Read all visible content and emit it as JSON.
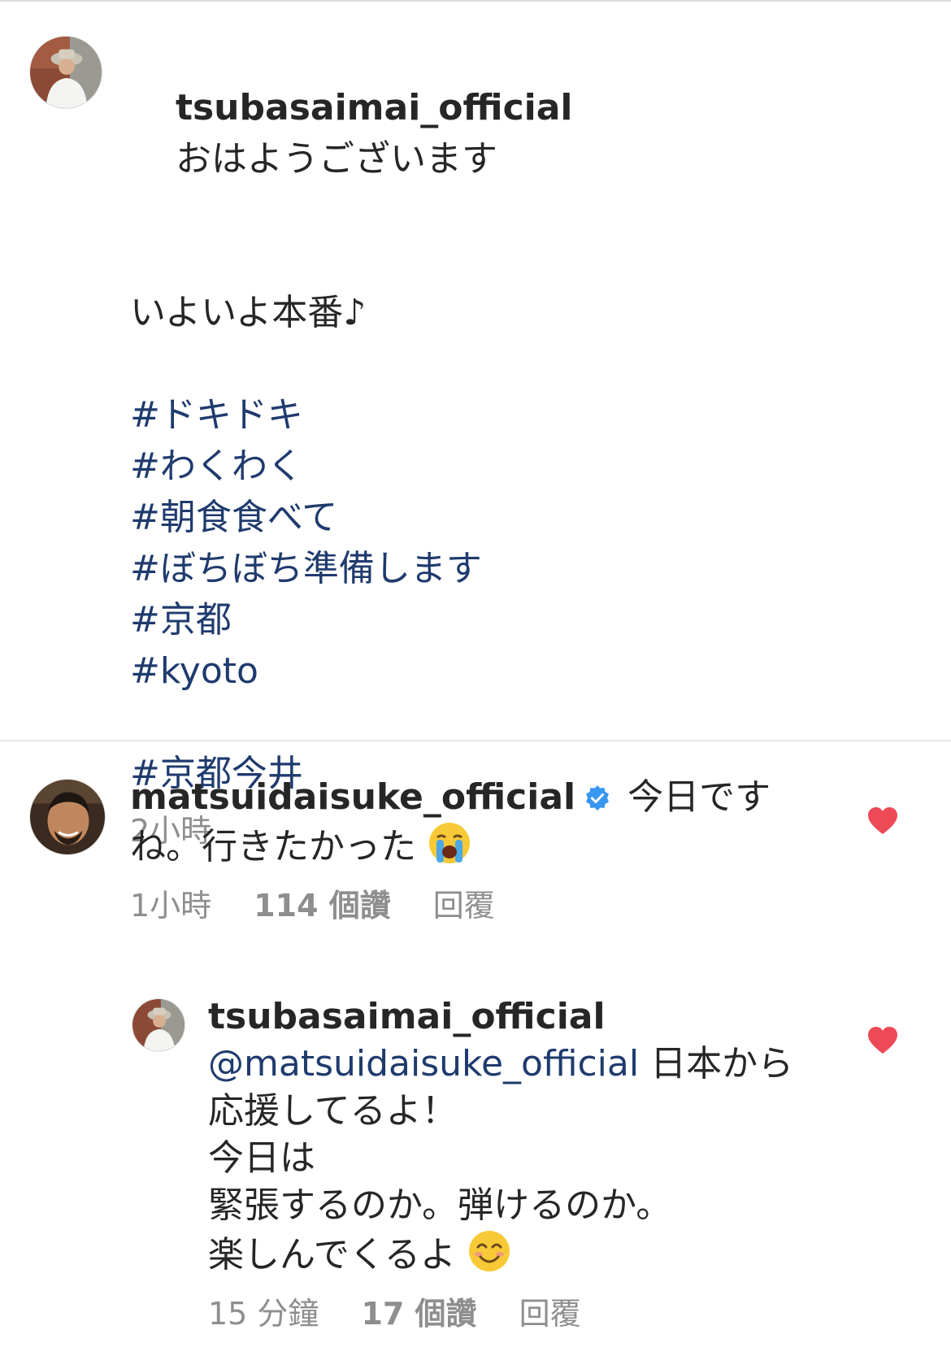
{
  "post": {
    "username": "tsubasaimai_official",
    "first_line": "おはようございます",
    "body_line": "いよいよ本番♪",
    "hashtags": [
      "#ドキドキ",
      "#わくわく",
      "#朝食食べて",
      "#ぼちぼち準備します",
      "#京都",
      "#kyoto"
    ],
    "last_hashtag": "#京都今井",
    "time": "2小時"
  },
  "comment1": {
    "username": "matsuidaisuke_official",
    "text_line1": "今日です",
    "text_line2": "ね。行きたかった",
    "emoji": "loudly-crying-face",
    "time": "1小時",
    "likes": "114 個讚",
    "reply_label": "回覆"
  },
  "reply1": {
    "username": "tsubasaimai_official",
    "mention": "@matsuidaisuke_official",
    "text_after_mention": " 日本から",
    "lines": [
      "応援してるよ！",
      "今日は",
      "緊張するのか。弾けるのか。",
      "楽しんでくるよ"
    ],
    "emoji": "smiling-face-with-smiling-eyes",
    "time": "15 分鐘",
    "likes": "17 個讚",
    "reply_label": "回覆"
  },
  "colors": {
    "hashtag": "#1f3b6e",
    "muted": "#8e8e8e",
    "heart": "#ed4956",
    "verified": "#3897f0"
  }
}
